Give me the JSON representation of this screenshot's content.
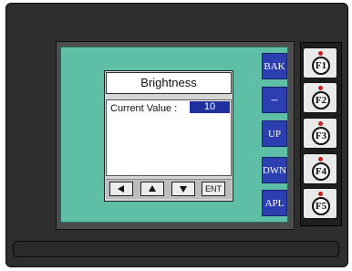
{
  "dialog": {
    "title": "Brightness",
    "current_value_label": "Current Value :",
    "current_value": "10",
    "enter_label": "ENT"
  },
  "side_keys": [
    "BAK",
    "–",
    "UP",
    "DWN",
    "APL"
  ],
  "function_keys": [
    "F1",
    "F2",
    "F3",
    "F4",
    "F5"
  ],
  "colors": {
    "screen": "#5fbfa6",
    "side_key": "#2b3fb0",
    "value_highlight": "#1f2f9e",
    "led": "#d11a1a"
  }
}
